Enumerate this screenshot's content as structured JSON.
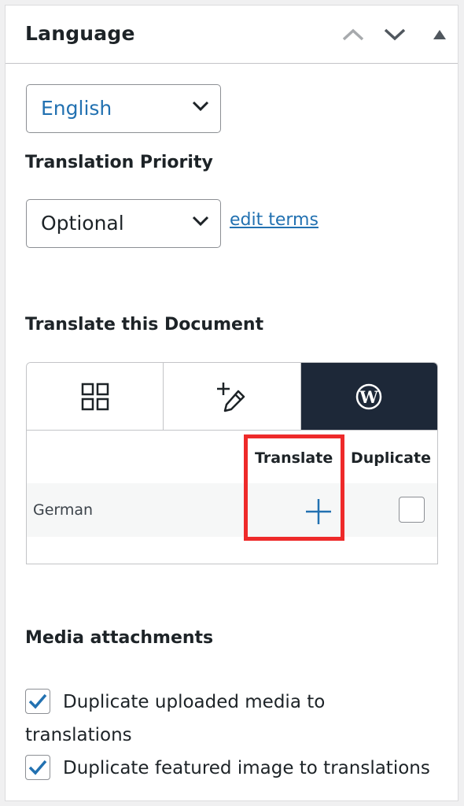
{
  "header": {
    "title": "Language"
  },
  "language": {
    "selected": "English"
  },
  "priority": {
    "label": "Translation Priority",
    "selected": "Optional",
    "edit_link": "edit terms"
  },
  "document": {
    "label": "Translate this Document",
    "tabs": [
      {
        "icon": "grid-icon"
      },
      {
        "icon": "add-pencil-icon"
      },
      {
        "icon": "wordpress-icon",
        "active": true
      }
    ],
    "columns": {
      "translate": "Translate",
      "duplicate": "Duplicate"
    },
    "rows": [
      {
        "language": "German",
        "translate_icon": "plus-icon",
        "duplicate_checked": false
      }
    ]
  },
  "media": {
    "label": "Media attachments",
    "options": [
      {
        "label": "Duplicate uploaded media to translations",
        "checked": true
      },
      {
        "label": "Duplicate featured image to translations",
        "checked": true
      }
    ]
  },
  "colors": {
    "link": "#2271b1",
    "active_tab": "#1d2838",
    "highlight": "#ee2a2a",
    "checkbox_check": "#2271b1"
  }
}
